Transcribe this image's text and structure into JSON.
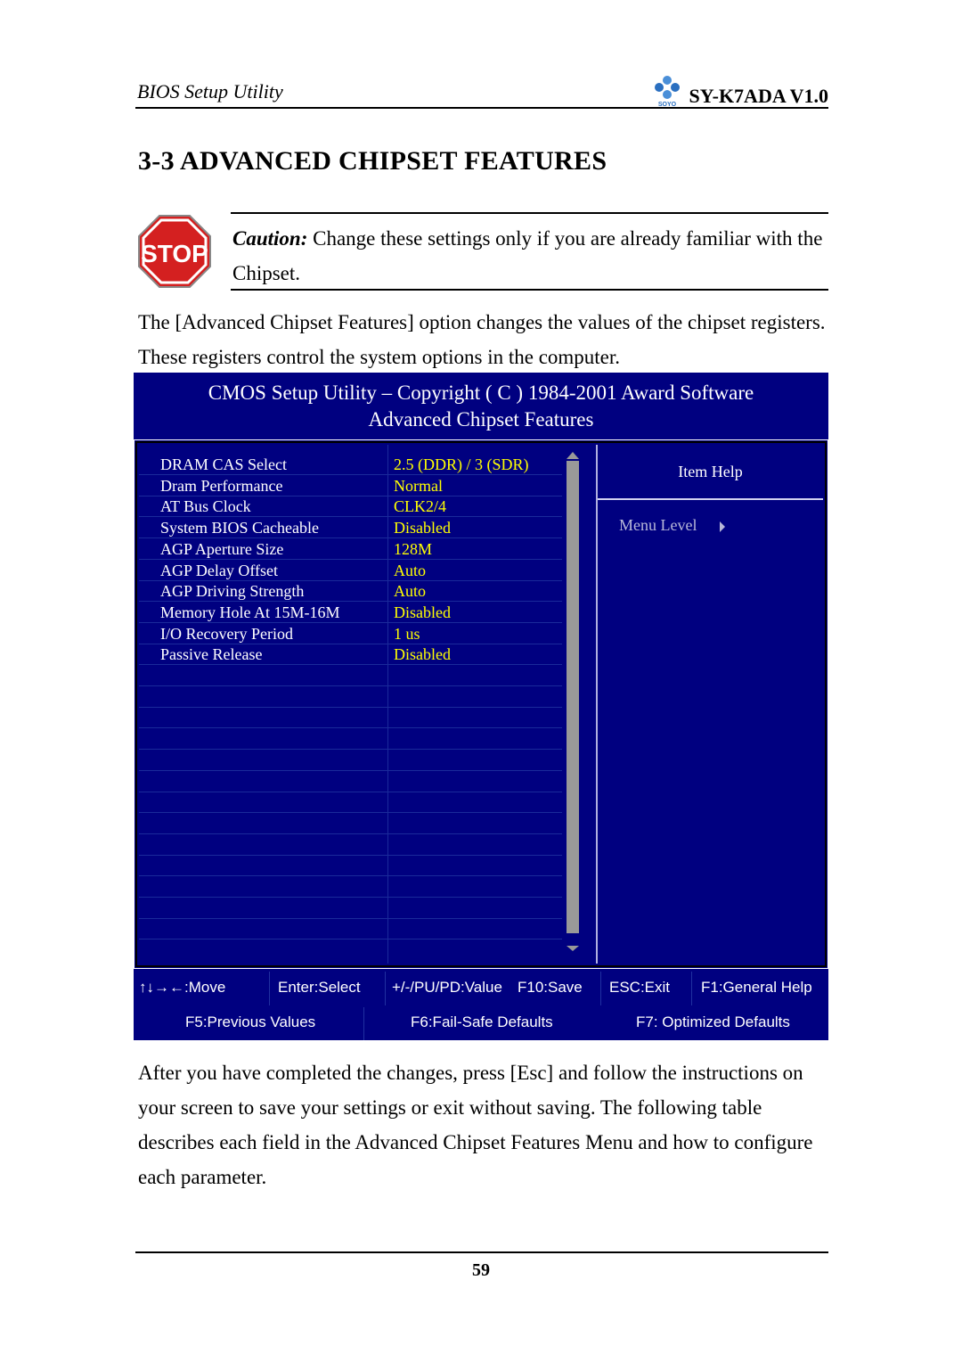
{
  "header": {
    "left_title": "BIOS Setup Utility",
    "right_title": "SY-K7ADA V1.0",
    "logo_caption": "SOYO"
  },
  "section_title": "3-3  ADVANCED CHIPSET FEATURES",
  "caution": {
    "icon_text": "STOP",
    "label": "Caution:",
    "text": " Change these settings only if you are already familiar with the Chipset."
  },
  "intro_paragraph": "The [Advanced Chipset Features] option changes the values of the chipset registers. These registers control the system options in the computer.",
  "bios": {
    "title_line1": "CMOS Setup Utility – Copyright ( C ) 1984-2001 Award Software",
    "title_line2": "Advanced Chipset Features",
    "settings": [
      {
        "label": "DRAM CAS Select",
        "value": "2.5 (DDR) / 3 (SDR)"
      },
      {
        "label": "Dram Performance",
        "value": "Normal"
      },
      {
        "label": "AT Bus Clock",
        "value": "CLK2/4"
      },
      {
        "label": "System BIOS Cacheable",
        "value": "Disabled"
      },
      {
        "label": "AGP Aperture Size",
        "value": "128M"
      },
      {
        "label": "AGP Delay Offset",
        "value": "Auto"
      },
      {
        "label": "AGP Driving Strength",
        "value": "Auto"
      },
      {
        "label": "Memory Hole At 15M-16M",
        "value": "Disabled"
      },
      {
        "label": "I/O Recovery Period",
        "value": "1 us"
      },
      {
        "label": "Passive Release",
        "value": "Disabled"
      }
    ],
    "item_help": "Item Help",
    "menu_level": "Menu Level",
    "keys_row1": [
      {
        "label": "↑↓→←:Move"
      },
      {
        "label": "Enter:Select"
      },
      {
        "label": "+/-/PU/PD:Value"
      },
      {
        "label": "F10:Save"
      },
      {
        "label": "ESC:Exit"
      },
      {
        "label": "F1:General Help"
      }
    ],
    "keys_row2": [
      {
        "label": "F5:Previous Values"
      },
      {
        "label": "F6:Fail-Safe Defaults"
      },
      {
        "label": "F7: Optimized Defaults"
      }
    ],
    "colors": {
      "background": "#000080",
      "label": "#ffffff",
      "value": "#ffff00",
      "scrollbar": "#999999"
    }
  },
  "closing_paragraph": "After you have completed the changes, press [Esc] and follow the instructions on your screen to save your settings or exit without saving. The following table describes each field in the Advanced Chipset Features Menu and how to configure each parameter.",
  "page_number": "59"
}
